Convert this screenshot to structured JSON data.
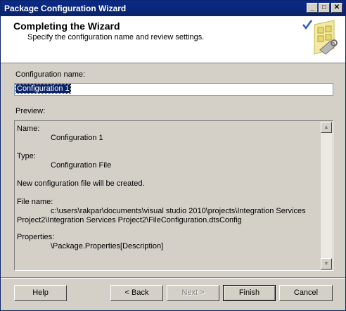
{
  "window": {
    "title": "Package Configuration Wizard",
    "controls": {
      "minimize": "_",
      "maximize": "□",
      "close": "✕"
    }
  },
  "header": {
    "title": "Completing the Wizard",
    "subtitle": "Specify the configuration name and review settings.",
    "icon": "wizard-checklist-icon"
  },
  "form": {
    "name_label": "Configuration name:",
    "name_value": "Configuration 1",
    "preview_label": "Preview:"
  },
  "preview": {
    "name_key": "Name:",
    "name_value": "Configuration 1",
    "type_key": "Type:",
    "type_value": "Configuration File",
    "note": "New configuration file will be created.",
    "file_key": "File name:",
    "file_value_line1": "c:\\users\\rakpar\\documents\\visual studio 2010\\projects\\Integration Services",
    "file_value_line2": "Project2\\Integration Services Project2\\FileConfiguration.dtsConfig",
    "properties_key": "Properties:",
    "properties_value": "\\Package.Properties[Description]"
  },
  "buttons": {
    "help": "Help",
    "back": "< Back",
    "next": "Next >",
    "finish": "Finish",
    "cancel": "Cancel"
  },
  "colors": {
    "titlebar": "#0a246a",
    "face": "#d4d0c8",
    "selection": "#0a246a"
  }
}
